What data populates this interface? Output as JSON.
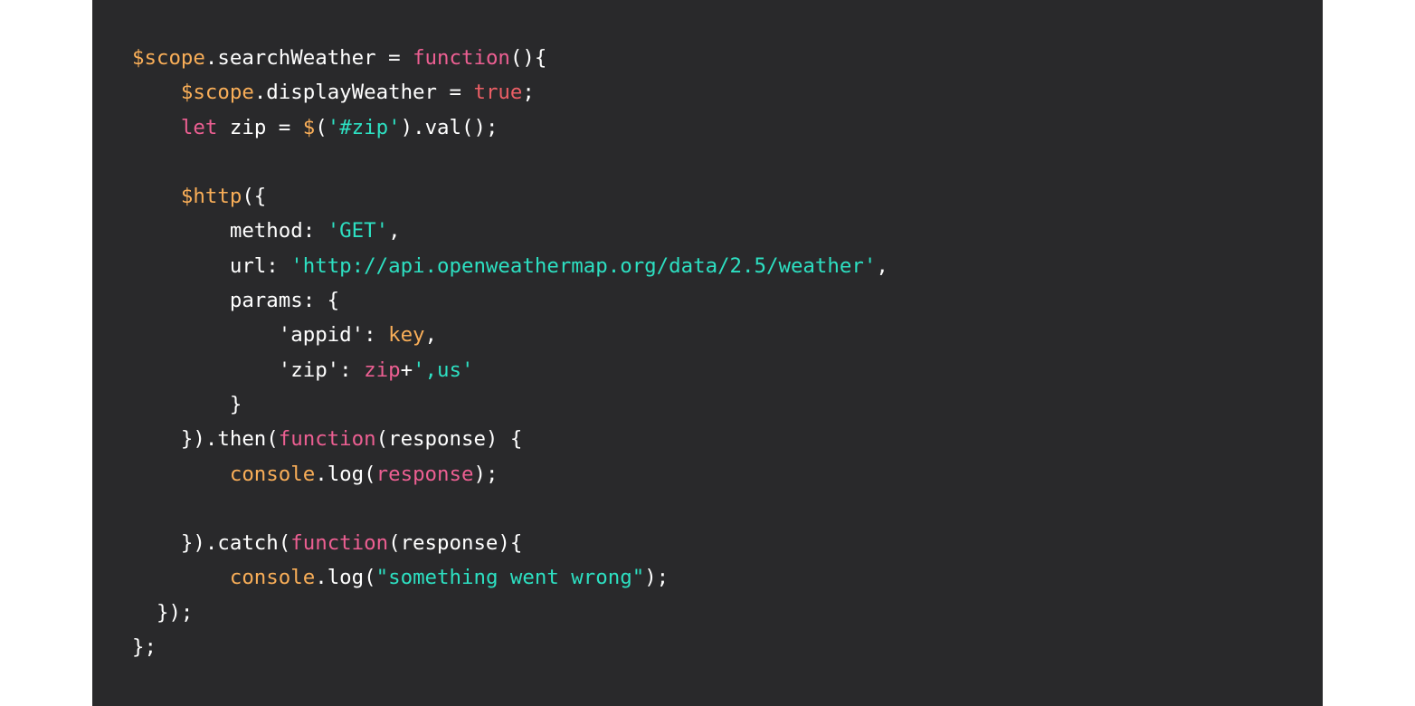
{
  "colors": {
    "background": "#ffffff",
    "code_background": "#29292b",
    "default": "#ffffff",
    "builtin": "#f9ae58",
    "keyword": "#ec5f92",
    "bool": "#ec5f66",
    "string": "#2de0c2"
  },
  "code_lines": [
    [
      {
        "text": "$scope",
        "type": "builtin"
      },
      {
        "text": ".searchWeather = ",
        "type": "default"
      },
      {
        "text": "function",
        "type": "keyword"
      },
      {
        "text": "(){",
        "type": "default"
      }
    ],
    [
      {
        "text": "    ",
        "type": "default"
      },
      {
        "text": "$scope",
        "type": "builtin"
      },
      {
        "text": ".displayWeather = ",
        "type": "default"
      },
      {
        "text": "true",
        "type": "bool"
      },
      {
        "text": ";",
        "type": "default"
      }
    ],
    [
      {
        "text": "    ",
        "type": "default"
      },
      {
        "text": "let",
        "type": "keyword"
      },
      {
        "text": " zip = ",
        "type": "default"
      },
      {
        "text": "$",
        "type": "builtin"
      },
      {
        "text": "(",
        "type": "default"
      },
      {
        "text": "'#zip'",
        "type": "string"
      },
      {
        "text": ").val();",
        "type": "default"
      }
    ],
    [
      {
        "text": "",
        "type": "default"
      }
    ],
    [
      {
        "text": "    ",
        "type": "default"
      },
      {
        "text": "$http",
        "type": "builtin"
      },
      {
        "text": "({",
        "type": "default"
      }
    ],
    [
      {
        "text": "        method: ",
        "type": "default"
      },
      {
        "text": "'GET'",
        "type": "string"
      },
      {
        "text": ",",
        "type": "default"
      }
    ],
    [
      {
        "text": "        url: ",
        "type": "default"
      },
      {
        "text": "'http://api.openweathermap.org/data/2.5/weather'",
        "type": "string"
      },
      {
        "text": ",",
        "type": "default"
      }
    ],
    [
      {
        "text": "        params: {",
        "type": "default"
      }
    ],
    [
      {
        "text": "            'appid': ",
        "type": "default"
      },
      {
        "text": "key",
        "type": "builtin"
      },
      {
        "text": ",",
        "type": "default"
      }
    ],
    [
      {
        "text": "            'zip': ",
        "type": "default"
      },
      {
        "text": "zip",
        "type": "keyword"
      },
      {
        "text": "+",
        "type": "default"
      },
      {
        "text": "',us'",
        "type": "string"
      }
    ],
    [
      {
        "text": "        }",
        "type": "default"
      }
    ],
    [
      {
        "text": "    }).then(",
        "type": "default"
      },
      {
        "text": "function",
        "type": "keyword"
      },
      {
        "text": "(response) {",
        "type": "default"
      }
    ],
    [
      {
        "text": "        ",
        "type": "default"
      },
      {
        "text": "console",
        "type": "builtin"
      },
      {
        "text": ".log(",
        "type": "default"
      },
      {
        "text": "response",
        "type": "keyword"
      },
      {
        "text": ");",
        "type": "default"
      }
    ],
    [
      {
        "text": "",
        "type": "default"
      }
    ],
    [
      {
        "text": "    }).catch(",
        "type": "default"
      },
      {
        "text": "function",
        "type": "keyword"
      },
      {
        "text": "(response){",
        "type": "default"
      }
    ],
    [
      {
        "text": "        ",
        "type": "default"
      },
      {
        "text": "console",
        "type": "builtin"
      },
      {
        "text": ".log(",
        "type": "default"
      },
      {
        "text": "\"something went wrong\"",
        "type": "string"
      },
      {
        "text": ");",
        "type": "default"
      }
    ],
    [
      {
        "text": "  });",
        "type": "default"
      }
    ],
    [
      {
        "text": "};",
        "type": "default"
      }
    ]
  ]
}
